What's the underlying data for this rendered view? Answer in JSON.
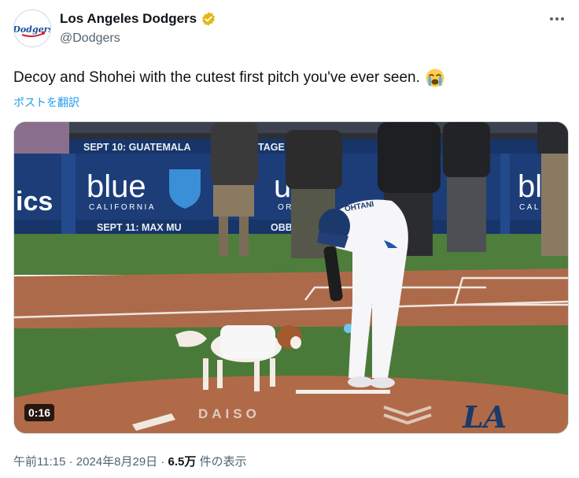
{
  "author": {
    "display_name": "Los Angeles Dodgers",
    "handle": "@Dodgers",
    "verified_color": "#e2b719",
    "avatar_text": "Dodgers"
  },
  "tweet": {
    "text": "Decoy and Shohei with the cutest first pitch you've ever seen.",
    "emoji": "loudly-crying-face",
    "translate_label": "ポストを翻訳"
  },
  "media": {
    "duration": "0:16",
    "banner_top": "SEPT 10: GUATEMALA",
    "banner_top_right": "TAGE",
    "banner_bottom": "SEPT 11: MAX MU",
    "banner_bottom_right": "OBBI",
    "ad_brand": "blue",
    "ad_brand_sub": "CALIFORNIA",
    "ad_brand_right": "ue",
    "ad_brand_right_sub": "ORNIA",
    "ad_left_fragment": "ics",
    "ad_far_right": "bl",
    "ad_far_right_sub": "CAL",
    "jersey_text": "OHTANI",
    "mound_text": "DAISO",
    "field_logo": "LA"
  },
  "meta": {
    "time": "午前11:15",
    "separator": "·",
    "date": "2024年8月29日",
    "views": "6.5万",
    "views_suffix": "件の表示"
  },
  "colors": {
    "link": "#1d9bf0",
    "secondary_text": "#536471",
    "dodger_blue": "#1b3a6b",
    "grass": "#4a7a3a",
    "dirt": "#b06a48"
  }
}
